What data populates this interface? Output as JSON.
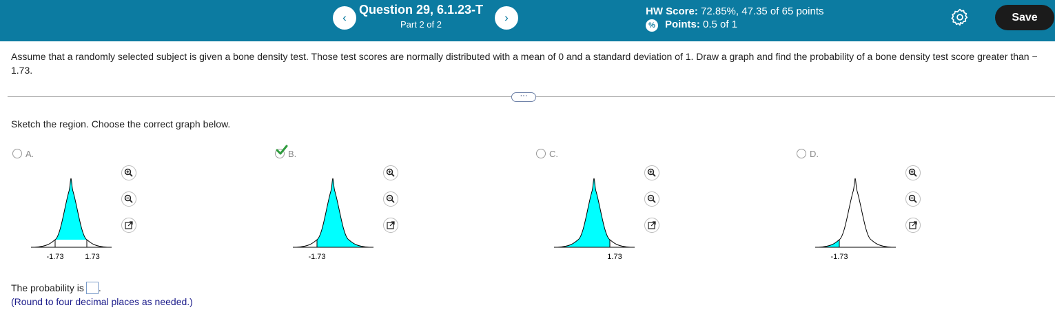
{
  "header": {
    "question_title": "Question 29, 6.1.23-T",
    "part": "Part 2 of 2",
    "hw_score_label": "HW Score:",
    "hw_score_value": "72.85%, 47.35 of 65 points",
    "points_label": "Points:",
    "points_value": "0.5 of 1",
    "save_label": "Save",
    "prev_glyph": "‹",
    "next_glyph": "›"
  },
  "question_text": "Assume that a randomly selected subject is given a bone density test. Those test scores are normally distributed with a mean of 0 and a standard deviation of 1. Draw a graph and find the probability of a bone density test score greater than − 1.73.",
  "more_label": "···",
  "prompt": "Sketch the region. Choose the correct graph below.",
  "options": [
    {
      "label": "A.",
      "tick_labels": [
        "-1.73",
        "1.73"
      ],
      "selected": false
    },
    {
      "label": "B.",
      "tick_labels": [
        "-1.73"
      ],
      "selected": true
    },
    {
      "label": "C.",
      "tick_labels": [
        "1.73"
      ],
      "selected": false
    },
    {
      "label": "D.",
      "tick_labels": [
        "-1.73"
      ],
      "selected": false
    }
  ],
  "answer": {
    "prefix": "The probability is",
    "suffix": ".",
    "hint": "(Round to four decimal places as needed.)"
  },
  "colors": {
    "header_bg": "#0c7ba1",
    "curve_fill": "#00ffff",
    "check": "#2e9b3d"
  },
  "icons": [
    "chevron-left-icon",
    "chevron-right-icon",
    "points-icon",
    "gear-icon",
    "check-icon",
    "zoom-in-icon",
    "zoom-out-icon",
    "popout-icon"
  ]
}
